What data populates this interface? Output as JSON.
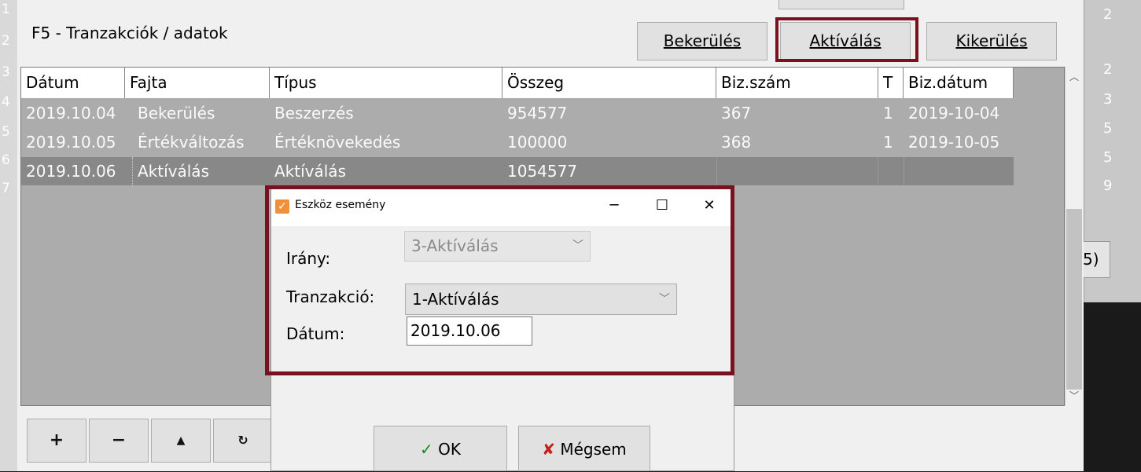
{
  "main": {
    "title": "F5 - Tranzakciók / adatok",
    "buttons": {
      "bekerules": "Bekerülés",
      "aktivalas": "Aktíválás",
      "kikerules": "Kikerülés"
    }
  },
  "grid": {
    "columns": [
      "Dátum",
      "Fajta",
      "Típus",
      "Összeg",
      "Biz.szám",
      "T",
      "Biz.dátum"
    ],
    "rows": [
      [
        "2019.10.04",
        "Bekerülés",
        "Beszerzés",
        "954577",
        "367",
        "1",
        "2019-10-04"
      ],
      [
        "2019.10.05",
        "Értékváltozás",
        "Értéknövekedés",
        "100000",
        "368",
        "1",
        "2019-10-05"
      ],
      [
        "2019.10.06",
        "Aktíválás",
        "Aktíválás",
        "1054577",
        "",
        "",
        ""
      ]
    ]
  },
  "left_row_numbers": [
    "1",
    "2",
    "3",
    "4",
    "5",
    "6",
    "7"
  ],
  "right_row_numbers": [
    "2",
    "2",
    "3",
    "5",
    "5",
    "9"
  ],
  "right_fragment": "5)",
  "bottom_toolbar": {
    "add": "+",
    "remove": "−",
    "up": "▲",
    "refresh": "↻"
  },
  "dialog": {
    "title": "Eszköz esemény",
    "irany_label": "Irány:",
    "irany_value": "3-Aktíválás",
    "tranzakcio_label": "Tranzakció:",
    "tranzakcio_value": "1-Aktíválás",
    "datum_label": "Dátum:",
    "datum_value": "2019.10.06",
    "ok_label": "OK",
    "cancel_label": "Mégsem"
  },
  "colors": {
    "highlight": "#7a1020",
    "row_fill": "#acacac",
    "selected_row": "#888888"
  }
}
